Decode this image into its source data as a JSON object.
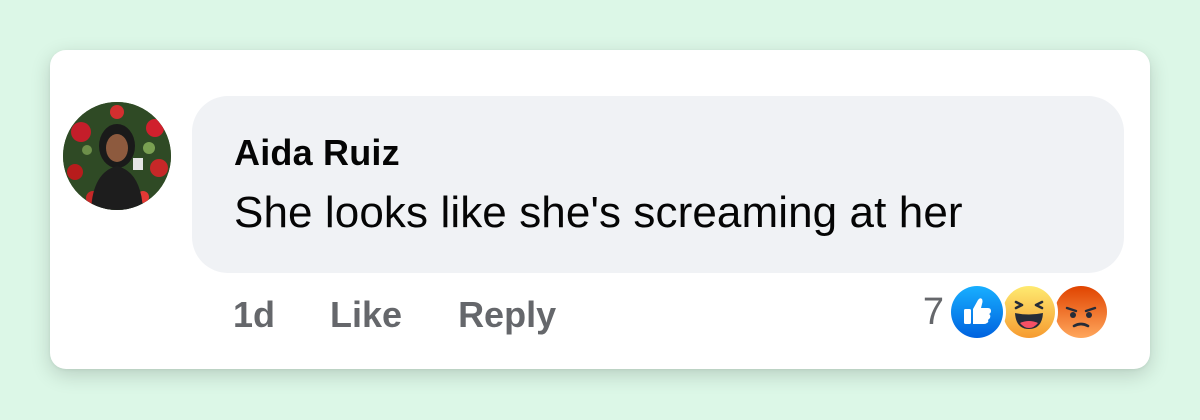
{
  "comment": {
    "author": "Aida Ruiz",
    "text": "She looks like she's screaming at her",
    "time": "1d",
    "like_label": "Like",
    "reply_label": "Reply",
    "reaction_count": "7",
    "reactions": [
      "like-icon",
      "haha-icon",
      "angry-icon"
    ]
  },
  "colors": {
    "page_bg": "#dcf7e7",
    "bubble_bg": "#f0f2f5",
    "muted_text": "#65676b",
    "like_blue": "#1877f2",
    "haha_yellow": "#f7b125",
    "angry_orange": "#e9710f"
  }
}
